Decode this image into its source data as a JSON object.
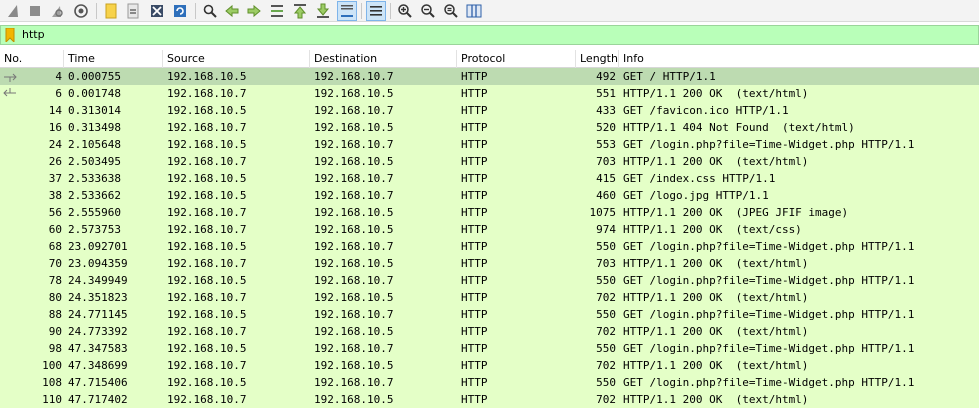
{
  "toolbar": {
    "buttons": [
      {
        "icon": "shark-fin-start-icon"
      },
      {
        "icon": "stop-capture-icon"
      },
      {
        "icon": "restart-capture-icon"
      },
      {
        "icon": "capture-options-icon"
      },
      {
        "icon": "open-file-icon"
      },
      {
        "icon": "save-file-icon"
      },
      {
        "icon": "close-file-icon"
      },
      {
        "icon": "reload-file-icon"
      },
      {
        "icon": "find-packet-icon"
      },
      {
        "icon": "go-back-icon"
      },
      {
        "icon": "go-forward-icon"
      },
      {
        "icon": "go-to-packet-icon"
      },
      {
        "icon": "go-first-packet-icon"
      },
      {
        "icon": "go-last-packet-icon"
      },
      {
        "icon": "auto-scroll-icon"
      },
      {
        "icon": "colorize-icon"
      },
      {
        "icon": "zoom-in-icon"
      },
      {
        "icon": "zoom-out-icon"
      },
      {
        "icon": "normal-size-icon"
      },
      {
        "icon": "resize-columns-icon"
      }
    ]
  },
  "filter": {
    "value": "http"
  },
  "columns": {
    "no": "No.",
    "time": "Time",
    "source": "Source",
    "destination": "Destination",
    "protocol": "Protocol",
    "length": "Length",
    "info": "Info"
  },
  "colors": {
    "http_row": "#e4ffc7",
    "selected_row": "#bddbb1",
    "filter_valid": "#b9ffb9"
  },
  "packets": [
    {
      "no": "4",
      "time": "0.000755",
      "source": "192.168.10.5",
      "destination": "192.168.10.7",
      "protocol": "HTTP",
      "length": "492",
      "info": "GET / HTTP/1.1"
    },
    {
      "no": "6",
      "time": "0.001748",
      "source": "192.168.10.7",
      "destination": "192.168.10.5",
      "protocol": "HTTP",
      "length": "551",
      "info": "HTTP/1.1 200 OK  (text/html)"
    },
    {
      "no": "14",
      "time": "0.313014",
      "source": "192.168.10.5",
      "destination": "192.168.10.7",
      "protocol": "HTTP",
      "length": "433",
      "info": "GET /favicon.ico HTTP/1.1"
    },
    {
      "no": "16",
      "time": "0.313498",
      "source": "192.168.10.7",
      "destination": "192.168.10.5",
      "protocol": "HTTP",
      "length": "520",
      "info": "HTTP/1.1 404 Not Found  (text/html)"
    },
    {
      "no": "24",
      "time": "2.105648",
      "source": "192.168.10.5",
      "destination": "192.168.10.7",
      "protocol": "HTTP",
      "length": "553",
      "info": "GET /login.php?file=Time-Widget.php HTTP/1.1"
    },
    {
      "no": "26",
      "time": "2.503495",
      "source": "192.168.10.7",
      "destination": "192.168.10.5",
      "protocol": "HTTP",
      "length": "703",
      "info": "HTTP/1.1 200 OK  (text/html)"
    },
    {
      "no": "37",
      "time": "2.533638",
      "source": "192.168.10.5",
      "destination": "192.168.10.7",
      "protocol": "HTTP",
      "length": "415",
      "info": "GET /index.css HTTP/1.1"
    },
    {
      "no": "38",
      "time": "2.533662",
      "source": "192.168.10.5",
      "destination": "192.168.10.7",
      "protocol": "HTTP",
      "length": "460",
      "info": "GET /logo.jpg HTTP/1.1"
    },
    {
      "no": "56",
      "time": "2.555960",
      "source": "192.168.10.7",
      "destination": "192.168.10.5",
      "protocol": "HTTP",
      "length": "1075",
      "info": "HTTP/1.1 200 OK  (JPEG JFIF image)"
    },
    {
      "no": "60",
      "time": "2.573753",
      "source": "192.168.10.7",
      "destination": "192.168.10.5",
      "protocol": "HTTP",
      "length": "974",
      "info": "HTTP/1.1 200 OK  (text/css)"
    },
    {
      "no": "68",
      "time": "23.092701",
      "source": "192.168.10.5",
      "destination": "192.168.10.7",
      "protocol": "HTTP",
      "length": "550",
      "info": "GET /login.php?file=Time-Widget.php HTTP/1.1"
    },
    {
      "no": "70",
      "time": "23.094359",
      "source": "192.168.10.7",
      "destination": "192.168.10.5",
      "protocol": "HTTP",
      "length": "703",
      "info": "HTTP/1.1 200 OK  (text/html)"
    },
    {
      "no": "78",
      "time": "24.349949",
      "source": "192.168.10.5",
      "destination": "192.168.10.7",
      "protocol": "HTTP",
      "length": "550",
      "info": "GET /login.php?file=Time-Widget.php HTTP/1.1"
    },
    {
      "no": "80",
      "time": "24.351823",
      "source": "192.168.10.7",
      "destination": "192.168.10.5",
      "protocol": "HTTP",
      "length": "702",
      "info": "HTTP/1.1 200 OK  (text/html)"
    },
    {
      "no": "88",
      "time": "24.771145",
      "source": "192.168.10.5",
      "destination": "192.168.10.7",
      "protocol": "HTTP",
      "length": "550",
      "info": "GET /login.php?file=Time-Widget.php HTTP/1.1"
    },
    {
      "no": "90",
      "time": "24.773392",
      "source": "192.168.10.7",
      "destination": "192.168.10.5",
      "protocol": "HTTP",
      "length": "702",
      "info": "HTTP/1.1 200 OK  (text/html)"
    },
    {
      "no": "98",
      "time": "47.347583",
      "source": "192.168.10.5",
      "destination": "192.168.10.7",
      "protocol": "HTTP",
      "length": "550",
      "info": "GET /login.php?file=Time-Widget.php HTTP/1.1"
    },
    {
      "no": "100",
      "time": "47.348699",
      "source": "192.168.10.7",
      "destination": "192.168.10.5",
      "protocol": "HTTP",
      "length": "702",
      "info": "HTTP/1.1 200 OK  (text/html)"
    },
    {
      "no": "108",
      "time": "47.715406",
      "source": "192.168.10.5",
      "destination": "192.168.10.7",
      "protocol": "HTTP",
      "length": "550",
      "info": "GET /login.php?file=Time-Widget.php HTTP/1.1"
    },
    {
      "no": "110",
      "time": "47.717402",
      "source": "192.168.10.7",
      "destination": "192.168.10.5",
      "protocol": "HTTP",
      "length": "702",
      "info": "HTTP/1.1 200 OK  (text/html)"
    }
  ]
}
